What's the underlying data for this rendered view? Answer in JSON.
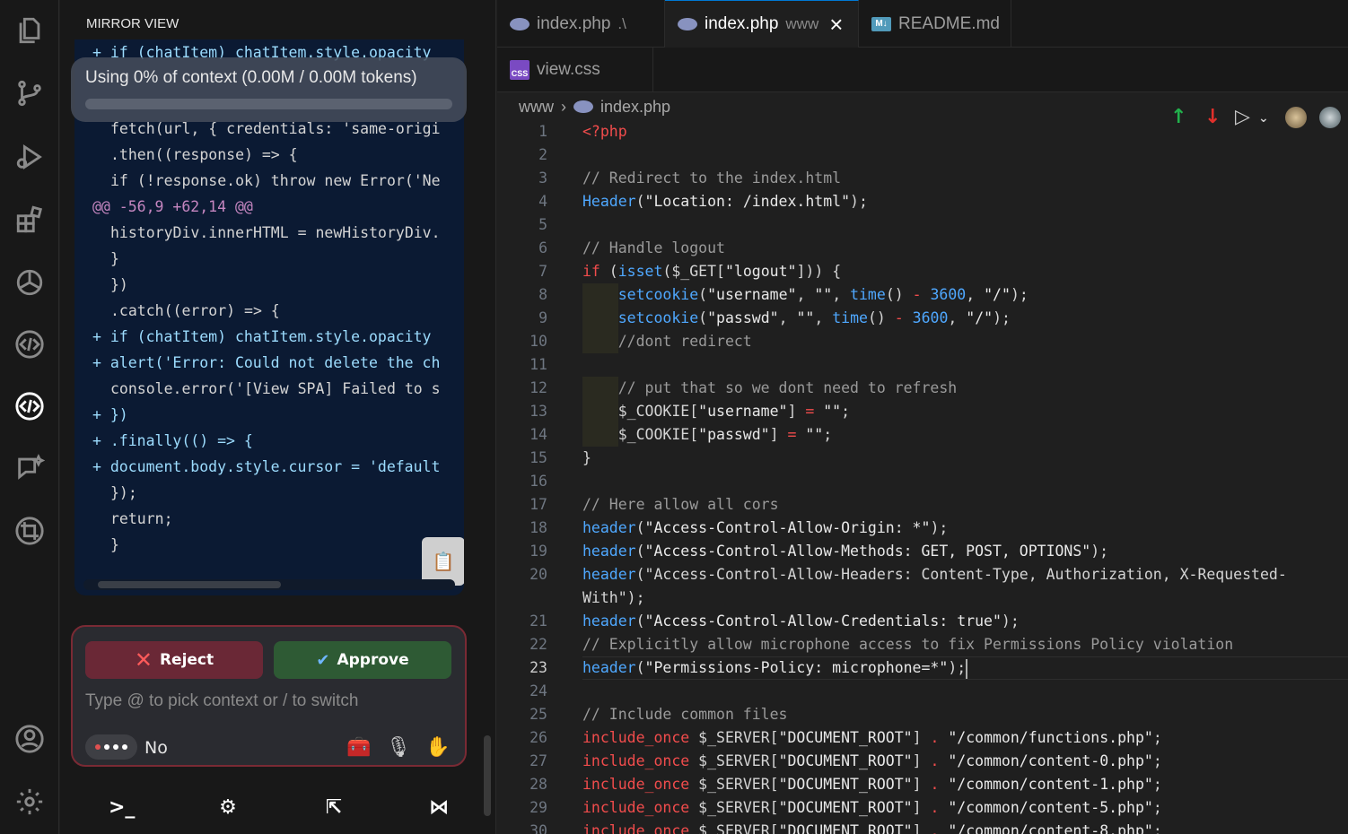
{
  "side_panel": {
    "title": "MIRROR VIEW",
    "context_text": "Using 0% of context (0.00M / 0.00M tokens)",
    "diff_lines": [
      "+ if (chatItem) chatItem.style.opacity",
      "fetch(url, { credentials: 'same-origi",
      ".then((response) => {",
      "if (!response.ok) throw new Error('Ne",
      "@@ -56,9 +62,14 @@",
      "historyDiv.innerHTML = newHistoryDiv.",
      "}",
      "})",
      ".catch((error) => {",
      "+ if (chatItem) chatItem.style.opacity",
      "+ alert('Error: Could not delete the ch",
      "console.error('[View SPA] Failed to s",
      "+ })",
      "+ .finally(() => {",
      "+ document.body.style.cursor = 'default",
      "});",
      "return;",
      "}"
    ],
    "reject_label": "Reject",
    "approve_label": "Approve",
    "input_placeholder": "Type @ to pick context or / to switch",
    "mode_label": "No"
  },
  "editor": {
    "tabs": [
      {
        "name": "index.php",
        "desc": ".\\"
      },
      {
        "name": "index.php",
        "desc": "www"
      },
      {
        "name": "README.md",
        "desc": ""
      }
    ],
    "tab_row2": [
      {
        "name": "view.css"
      }
    ],
    "breadcrumb": [
      "www",
      "index.php"
    ],
    "current_line": 23,
    "lines": [
      "<?php",
      "",
      "// Redirect to the index.html",
      "Header(\"Location: /index.html\");",
      "",
      "// Handle logout",
      "if (isset($_GET[\"logout\"])) {",
      "    setcookie(\"username\", \"\", time() - 3600, \"/\");",
      "    setcookie(\"passwd\", \"\", time() - 3600, \"/\");",
      "    //dont redirect",
      "",
      "    // put that so we dont need to refresh",
      "    $_COOKIE[\"username\"] = \"\";",
      "    $_COOKIE[\"passwd\"] = \"\";",
      "}",
      "",
      "// Here allow all cors",
      "header(\"Access-Control-Allow-Origin: *\");",
      "header(\"Access-Control-Allow-Methods: GET, POST, OPTIONS\");",
      "header(\"Access-Control-Allow-Headers: Content-Type, Authorization, X-Requested-",
      "With\");",
      "header(\"Access-Control-Allow-Credentials: true\");",
      "// Explicitly allow microphone access to fix Permissions Policy violation",
      "header(\"Permissions-Policy: microphone=*\");",
      "",
      "// Include common files",
      "include_once $_SERVER[\"DOCUMENT_ROOT\"] . \"/common/functions.php\";",
      "include_once $_SERVER[\"DOCUMENT_ROOT\"] . \"/common/content-0.php\";",
      "include_once $_SERVER[\"DOCUMENT_ROOT\"] . \"/common/content-1.php\";",
      "include_once $_SERVER[\"DOCUMENT_ROOT\"] . \"/common/content-5.php\";",
      "include_once $_SERVER[\"DOCUMENT_ROOT\"] . \"/common/content-8.php\";"
    ],
    "line_numbers": [
      "1",
      "2",
      "3",
      "4",
      "5",
      "6",
      "7",
      "8",
      "9",
      "10",
      "11",
      "12",
      "13",
      "14",
      "15",
      "16",
      "17",
      "18",
      "19",
      "20",
      "",
      "21",
      "22",
      "23",
      "24",
      "25",
      "26",
      "27",
      "28",
      "29",
      "30"
    ]
  },
  "icons": {
    "activity": [
      "explorer-icon",
      "source-control-icon",
      "run-debug-icon",
      "extensions-icon",
      "openai-icon",
      "code-assistant-icon",
      "code-assistant-active-icon",
      "chat-sparkle-icon",
      "crop-icon",
      "account-icon",
      "settings-gear-icon"
    ]
  },
  "colors": {
    "accent": "#0078d4",
    "reject": "#6a2836",
    "approve": "#2e5a34",
    "diff_bg": "#0b1a33"
  }
}
